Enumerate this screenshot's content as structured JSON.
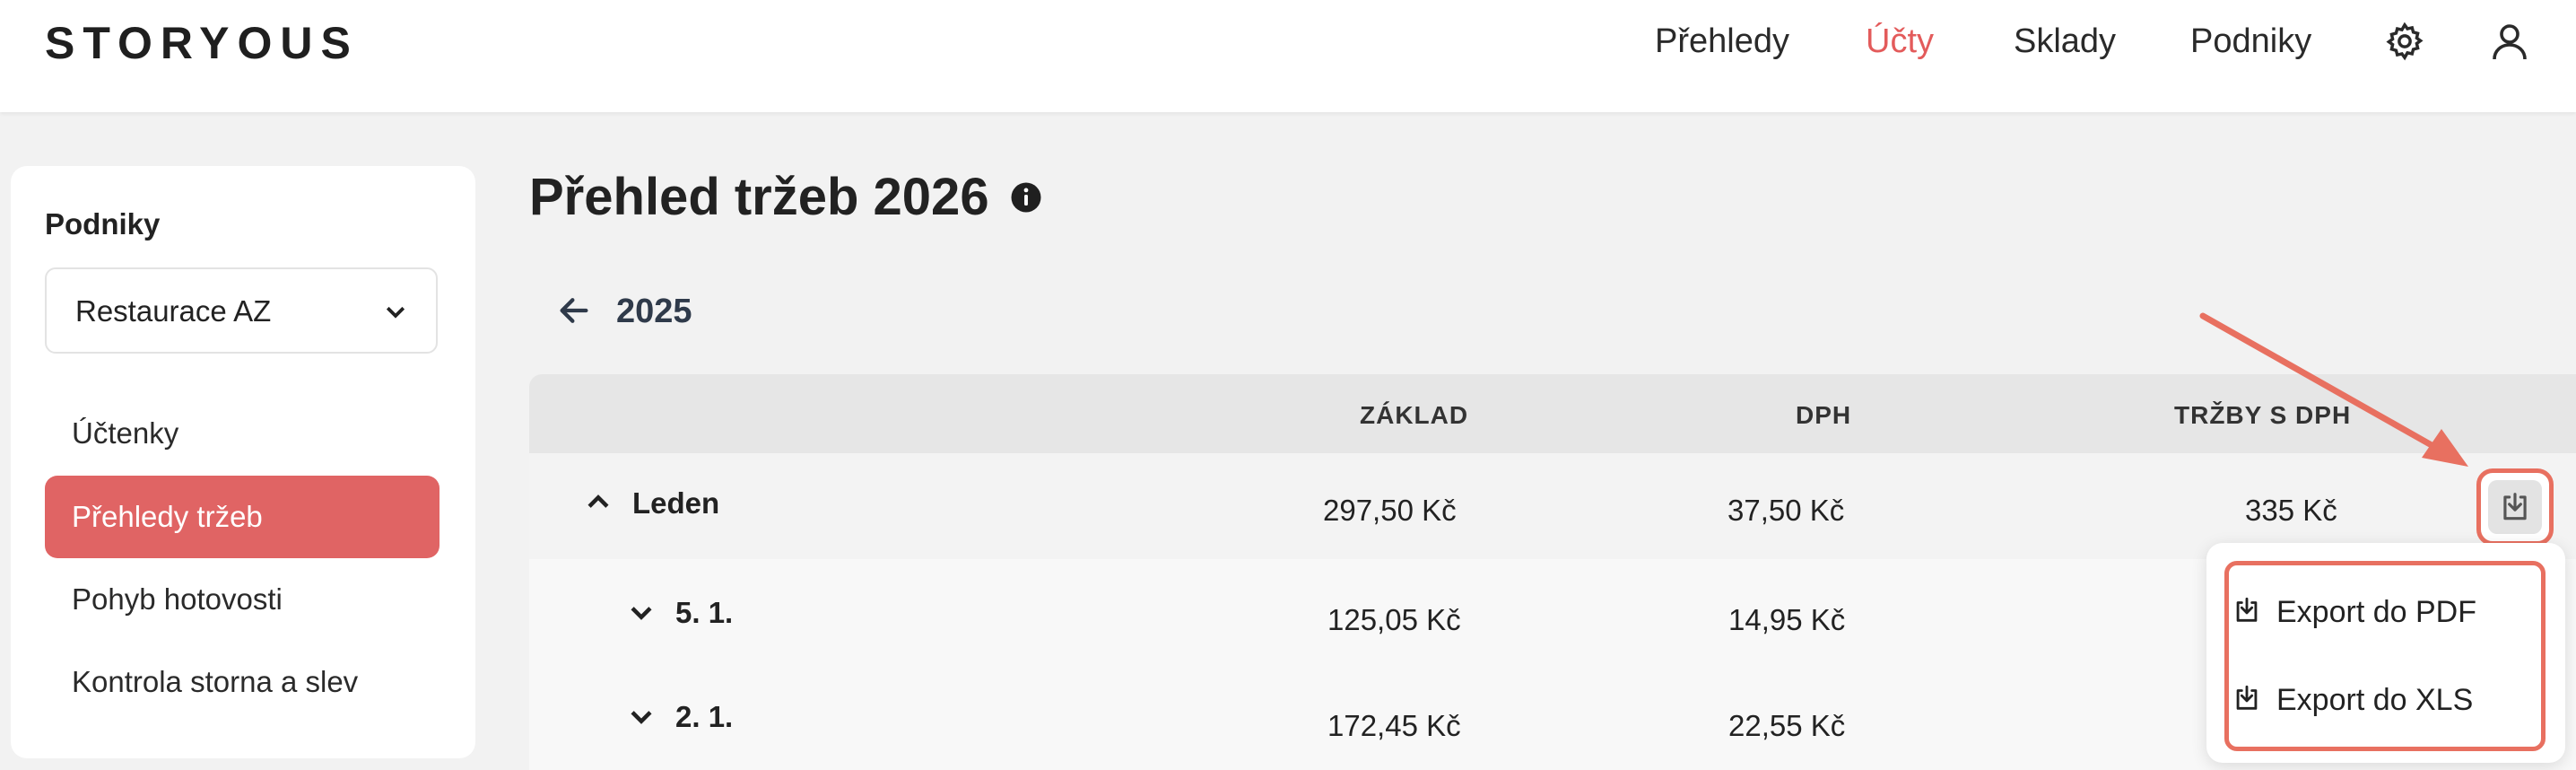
{
  "header": {
    "logo": "STORYOUS",
    "nav": [
      "Přehledy",
      "Účty",
      "Sklady",
      "Podniky"
    ],
    "active_nav": "Účty",
    "icons": [
      "gear-icon",
      "user-icon"
    ]
  },
  "sidebar": {
    "title": "Podniky",
    "select_value": "Restaurace AZ",
    "items": [
      {
        "label": "Účtenky"
      },
      {
        "label": "Přehledy tržeb",
        "active": true
      },
      {
        "label": "Pohyb hotovosti"
      },
      {
        "label": "Kontrola storna a slev"
      }
    ]
  },
  "main": {
    "title": "Přehled tržeb 2026",
    "prev_year": "2025",
    "table": {
      "headers": {
        "base": "ZÁKLAD",
        "vat": "DPH",
        "total": "TRŽBY S DPH"
      },
      "rows": [
        {
          "label": "Leden",
          "base": "297,50 Kč",
          "vat": "37,50 Kč",
          "total": "335 Kč"
        },
        {
          "label": "5. 1.",
          "base": "125,05 Kč",
          "vat": "14,95 Kč"
        },
        {
          "label": "2. 1.",
          "base": "172,45 Kč",
          "vat": "22,55 Kč"
        }
      ]
    },
    "export_menu": {
      "pdf": "Export do PDF",
      "xls": "Export do XLS"
    }
  },
  "colors": {
    "accent": "#e35b5b",
    "highlight": "#e87060",
    "sidebar_active": "#e06464"
  }
}
